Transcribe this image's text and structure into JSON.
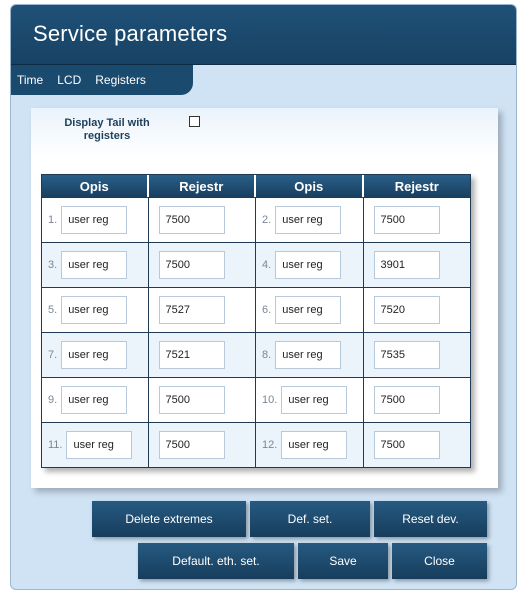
{
  "window": {
    "title": "Service parameters"
  },
  "tabs": [
    "Time",
    "LCD",
    "Registers"
  ],
  "display_tail": {
    "label": "Display Tail with registers",
    "checked": false
  },
  "grid": {
    "headers": [
      "Opis",
      "Rejestr",
      "Opis",
      "Rejestr"
    ],
    "rows": [
      {
        "left": {
          "num": "1.",
          "desc": "user reg",
          "value": "7500"
        },
        "right": {
          "num": "2.",
          "desc": "user reg",
          "value": "7500"
        }
      },
      {
        "left": {
          "num": "3.",
          "desc": "user reg",
          "value": "7500"
        },
        "right": {
          "num": "4.",
          "desc": "user reg",
          "value": "3901"
        }
      },
      {
        "left": {
          "num": "5.",
          "desc": "user reg",
          "value": "7527"
        },
        "right": {
          "num": "6.",
          "desc": "user reg",
          "value": "7520"
        }
      },
      {
        "left": {
          "num": "7.",
          "desc": "user reg",
          "value": "7521"
        },
        "right": {
          "num": "8.",
          "desc": "user reg",
          "value": "7535"
        }
      },
      {
        "left": {
          "num": "9.",
          "desc": "user reg",
          "value": "7500"
        },
        "right": {
          "num": "10.",
          "desc": "user reg",
          "value": "7500"
        }
      },
      {
        "left": {
          "num": "11.",
          "desc": "user reg",
          "value": "7500"
        },
        "right": {
          "num": "12.",
          "desc": "user reg",
          "value": "7500"
        }
      }
    ]
  },
  "buttons": {
    "delete_extremes": "Delete extremes",
    "def_set": "Def. set.",
    "reset_dev": "Reset dev.",
    "default_eth_set": "Default. eth. set.",
    "save": "Save",
    "close": "Close"
  }
}
